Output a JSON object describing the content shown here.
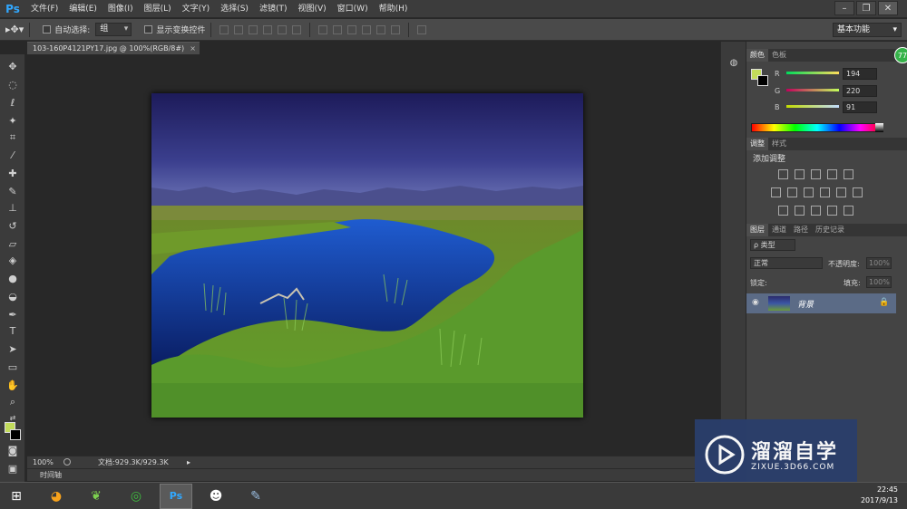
{
  "app": {
    "logo": "Ps"
  },
  "menu": [
    "文件(F)",
    "编辑(E)",
    "图像(I)",
    "图层(L)",
    "文字(Y)",
    "选择(S)",
    "滤镜(T)",
    "视图(V)",
    "窗口(W)",
    "帮助(H)"
  ],
  "window_controls": {
    "minimize": "–",
    "restore": "❐",
    "close": "✕"
  },
  "options": {
    "auto_select_label": "自动选择:",
    "auto_select_value": "组",
    "show_transform_label": "显示变换控件",
    "workspace": "基本功能"
  },
  "document_tab": {
    "title": "103-160P4121PY17.jpg @ 100%(RGB/8#)",
    "close": "×"
  },
  "status": {
    "zoom": "100%",
    "doc_info": "文档:929.3K/929.3K"
  },
  "timeline": {
    "label": "时间轴"
  },
  "color_panel": {
    "tabs": [
      "颜色",
      "色板"
    ],
    "r_label": "R",
    "g_label": "G",
    "b_label": "B",
    "r": 194,
    "g": 220,
    "b": 91,
    "foreground_color": "#c2dc5b"
  },
  "adjust_panel": {
    "tabs": [
      "调整",
      "样式"
    ],
    "title": "添加调整"
  },
  "layers_panel": {
    "tabs": [
      "图层",
      "通道",
      "路径",
      "历史记录"
    ],
    "filter_label": "ρ 类型",
    "blend_mode": "正常",
    "opacity_label": "不透明度:",
    "opacity_value": "100%",
    "lock_label": "锁定:",
    "fill_label": "填充:",
    "fill_value": "100%",
    "layer_name": "背景"
  },
  "badge": "77",
  "watermark": {
    "title": "溜溜自学",
    "url": "ZIXUE.3D66.COM"
  },
  "taskbar": {
    "time": "22:45",
    "date": "2017/9/13"
  },
  "colors": {
    "accent": "#31a8ff",
    "foreground": "#c2dc5b",
    "layer_selected": "#5b6b86"
  }
}
